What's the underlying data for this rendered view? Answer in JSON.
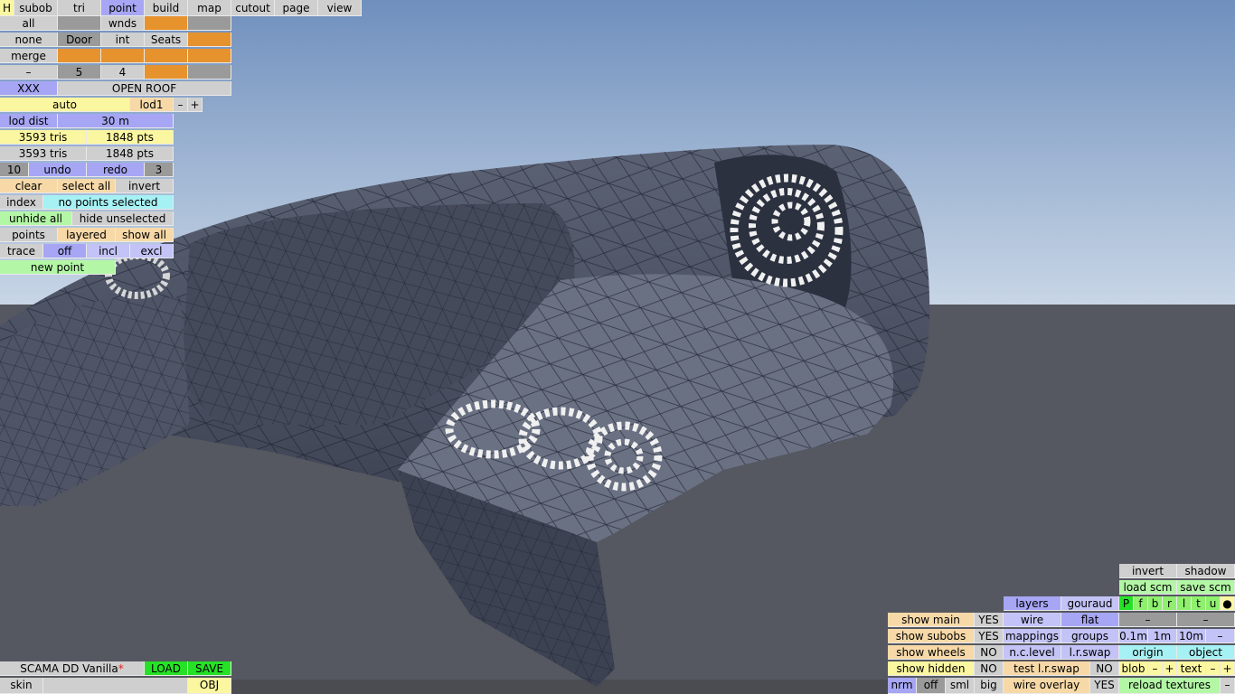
{
  "top_tabs": [
    "H",
    "subob",
    "tri",
    "point",
    "build",
    "map",
    "cutout",
    "page",
    "view"
  ],
  "row2": {
    "all": "all",
    "wnds": "wnds"
  },
  "row3": {
    "none": "none",
    "door": "Door",
    "int": "int",
    "seats": "Seats"
  },
  "row4": {
    "merge": "merge"
  },
  "row5": {
    "dash": "–",
    "five": "5",
    "four": "4"
  },
  "row6": {
    "xxx": "XXX",
    "open_roof": "OPEN ROOF"
  },
  "lod": {
    "auto": "auto",
    "lod1": "lod1",
    "minus": "–",
    "plus": "+",
    "dist_label": "lod dist",
    "dist_value": "30 m"
  },
  "stats": {
    "tris1": "3593 tris",
    "pts1": "1848 pts",
    "tris2": "3593 tris",
    "pts2": "1848 pts"
  },
  "history": {
    "count": "10",
    "undo": "undo",
    "redo": "redo",
    "redo_count": "3"
  },
  "select": {
    "clear": "clear",
    "select_all": "select all",
    "invert": "invert"
  },
  "index": {
    "label": "index",
    "status": "no points selected"
  },
  "hide": {
    "unhide_all": "unhide all",
    "hide_unselected": "hide unselected"
  },
  "points_row": {
    "points": "points",
    "layered": "layered",
    "show_all": "show all"
  },
  "trace_row": {
    "trace": "trace",
    "off": "off",
    "incl": "incl",
    "excl": "excl"
  },
  "new_point": "new point",
  "bottom_left": {
    "file_name": "SCAMA DD Vanilla",
    "modified_mark": "*",
    "load": "LOAD",
    "save": "SAVE",
    "skin": "skin",
    "obj": "OBJ"
  },
  "right_panel": {
    "invert": "invert",
    "shadow": "shadow",
    "load_scm": "load scm",
    "save_scm": "save scm",
    "view_letters": [
      "P",
      "f",
      "b",
      "r",
      "l",
      "t",
      "u"
    ],
    "layers": "layers",
    "gouraud": "gouraud",
    "wire": "wire",
    "flat": "flat",
    "dash": "–",
    "show_main": "show main",
    "show_main_val": "YES",
    "show_subobs": "show subobs",
    "show_subobs_val": "YES",
    "show_wheels": "show wheels",
    "show_wheels_val": "NO",
    "show_hidden": "show hidden",
    "show_hidden_val": "NO",
    "mappings": "mappings",
    "groups": "groups",
    "g01": "0.1m",
    "g1": "1m",
    "g10": "10m",
    "nc_level": "n.c.level",
    "lr_swap": "l.r.swap",
    "origin": "origin",
    "object": "object",
    "test_lr_swap": "test l.r.swap",
    "test_lr_swap_val": "NO",
    "blob": "blob",
    "minus": "–",
    "plus": "+",
    "text": "text",
    "wire_overlay": "wire overlay",
    "wire_overlay_val": "YES",
    "reload_textures": "reload textures",
    "nrm": "nrm",
    "off": "off",
    "sml": "sml",
    "big": "big"
  },
  "colors": {
    "sky_top": "#6f8fbd",
    "sky_bottom": "#c8d6e6",
    "ground": "#555860",
    "mesh": "#4d5466",
    "accent": "#e6922d"
  }
}
